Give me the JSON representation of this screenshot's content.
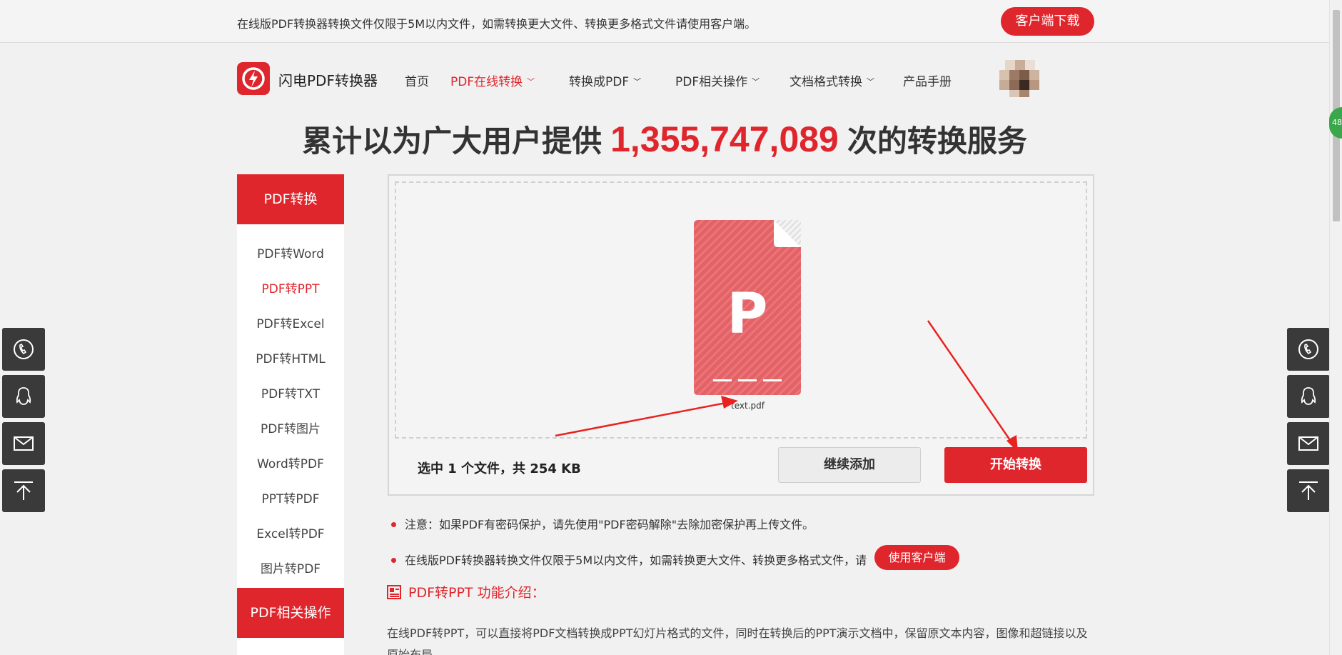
{
  "topbar": {
    "notice": "在线版PDF转换器转换文件仅限于5M以内文件，如需转换更大文件、转换更多格式文件请使用客户端。",
    "download_label": "客户端下载"
  },
  "nav": {
    "logo_text": "闪电PDF转换器",
    "items": [
      {
        "label": "首页"
      },
      {
        "label": "PDF在线转换"
      },
      {
        "label": "转换成PDF"
      },
      {
        "label": "PDF相关操作"
      },
      {
        "label": "文档格式转换"
      },
      {
        "label": "产品手册"
      }
    ]
  },
  "stats": {
    "prefix": "累计以为广大用户提供",
    "count": "1,355,747,089",
    "suffix": "次的转换服务"
  },
  "sidebar": {
    "section1": "PDF转换",
    "items": [
      {
        "label": "PDF转Word"
      },
      {
        "label": "PDF转PPT"
      },
      {
        "label": "PDF转Excel"
      },
      {
        "label": "PDF转HTML"
      },
      {
        "label": "PDF转TXT"
      },
      {
        "label": "PDF转图片"
      },
      {
        "label": "Word转PDF"
      },
      {
        "label": "PPT转PDF"
      },
      {
        "label": "Excel转PDF"
      },
      {
        "label": "图片转PDF"
      }
    ],
    "active_item": "PDF转PPT",
    "section2": "PDF相关操作"
  },
  "upload": {
    "file_letter": "P",
    "file_name": "text.pdf",
    "selected_summary": "选中 1 个文件，共 254 KB",
    "add_label": "继续添加",
    "start_label": "开始转换"
  },
  "notes": {
    "note1": "注意：如果PDF有密码保护，请先使用\"PDF密码解除\"去除加密保护再上传文件。",
    "note2": "在线版PDF转换器转换文件仅限于5M以内文件，如需转换更大文件、转换更多格式文件，请",
    "client_button": "使用客户端"
  },
  "intro": {
    "title": "PDF转PPT 功能介绍：",
    "text": "在线PDF转PPT，可以直接将PDF文档转换成PPT幻灯片格式的文件，同时在转换后的PPT演示文档中，保留原文本内容，图像和超链接以及原始布局"
  },
  "float_buttons": [
    "phone-icon",
    "qq-icon",
    "mail-icon",
    "back-to-top-icon"
  ],
  "side_badge": "48",
  "colors": {
    "brand_red": "#e0262d",
    "file_red": "#e46165",
    "dark_button": "#3a3a3a"
  }
}
